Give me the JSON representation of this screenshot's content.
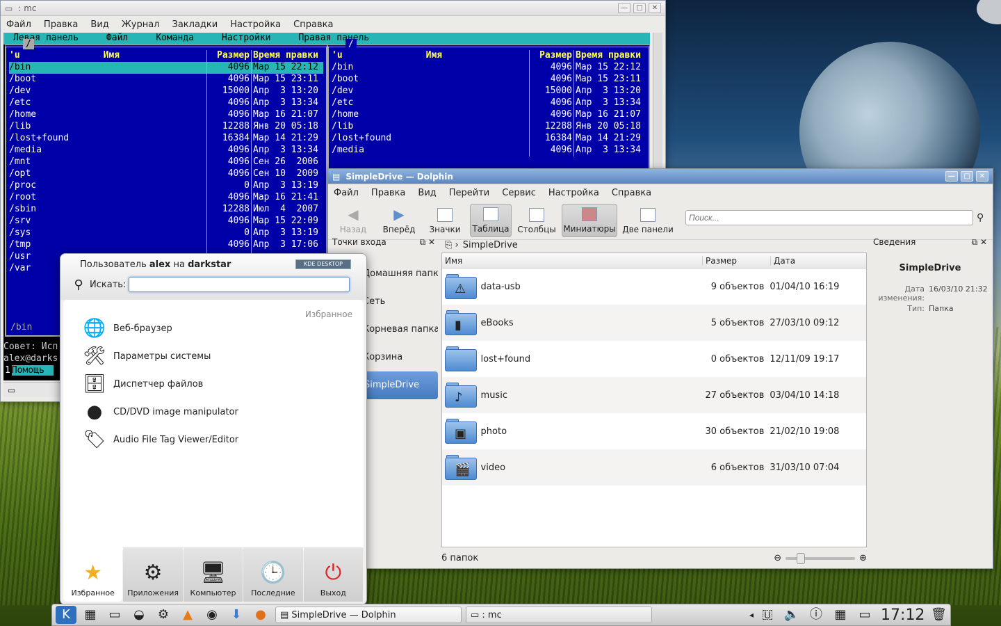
{
  "mc": {
    "title": ": mc",
    "menu": [
      "Файл",
      "Правка",
      "Вид",
      "Журнал",
      "Закладки",
      "Настройка",
      "Справка"
    ],
    "top_menu": [
      "Левая панель",
      "Файл",
      "Команда",
      "Настройки",
      "Правая панель"
    ],
    "columns": [
      "'u",
      "Имя",
      "Размер",
      "Время правки"
    ],
    "left_path": "/",
    "right_path": "/",
    "rows": [
      {
        "name": "/bin",
        "size": "4096",
        "time": "Мар 15 22:12"
      },
      {
        "name": "/boot",
        "size": "4096",
        "time": "Мар 15 23:11"
      },
      {
        "name": "/dev",
        "size": "15000",
        "time": "Апр  3 13:20"
      },
      {
        "name": "/etc",
        "size": "4096",
        "time": "Апр  3 13:34"
      },
      {
        "name": "/home",
        "size": "4096",
        "time": "Мар 16 21:07"
      },
      {
        "name": "/lib",
        "size": "12288",
        "time": "Янв 20 05:18"
      },
      {
        "name": "/lost+found",
        "size": "16384",
        "time": "Мар 14 21:29"
      },
      {
        "name": "/media",
        "size": "4096",
        "time": "Апр  3 13:34"
      },
      {
        "name": "/mnt",
        "size": "4096",
        "time": "Сен 26  2006"
      },
      {
        "name": "/opt",
        "size": "4096",
        "time": "Сен 10  2009"
      },
      {
        "name": "/proc",
        "size": "0",
        "time": "Апр  3 13:19"
      },
      {
        "name": "/root",
        "size": "4096",
        "time": "Мар 16 21:41"
      },
      {
        "name": "/sbin",
        "size": "12288",
        "time": "Июл  4  2007"
      },
      {
        "name": "/srv",
        "size": "4096",
        "time": "Мар 15 22:09"
      },
      {
        "name": "/sys",
        "size": "0",
        "time": "Апр  3 13:19"
      },
      {
        "name": "/tmp",
        "size": "4096",
        "time": "Апр  3 17:06"
      },
      {
        "name": "/usr",
        "size": "",
        "time": ""
      },
      {
        "name": "/var",
        "size": "",
        "time": ""
      }
    ],
    "footer": "/bin",
    "hint": "Совет: Исп",
    "prompt": "alex@darks",
    "fkey": "1",
    "fkey_label": "Помощь"
  },
  "dolphin": {
    "title": "SimpleDrive — Dolphin",
    "menu": [
      "Файл",
      "Правка",
      "Вид",
      "Перейти",
      "Сервис",
      "Настройка",
      "Справка"
    ],
    "toolbar": {
      "back": "Назад",
      "forward": "Вперёд",
      "icons": "Значки",
      "table": "Таблица",
      "columns": "Столбцы",
      "preview": "Миниатюры",
      "split": "Две панели"
    },
    "search_placeholder": "Поиск...",
    "places_title": "Точки входа",
    "places": [
      "Домашняя папка",
      "Сеть",
      "Корневая папка",
      "Корзина",
      "SimpleDrive"
    ],
    "breadcrumb": "SimpleDrive",
    "headers": {
      "name": "Имя",
      "size": "Размер",
      "date": "Дата"
    },
    "files": [
      {
        "name": "data-usb",
        "size": "9 объектов",
        "date": "01/04/10 16:19",
        "emblem": "⚠"
      },
      {
        "name": "eBooks",
        "size": "5 объектов",
        "date": "27/03/10 09:12",
        "emblem": "▮"
      },
      {
        "name": "lost+found",
        "size": "0 объектов",
        "date": "12/11/09 19:17",
        "emblem": ""
      },
      {
        "name": "music",
        "size": "27 объектов",
        "date": "03/04/10 14:18",
        "emblem": "♪"
      },
      {
        "name": "photo",
        "size": "30 объектов",
        "date": "21/02/10 19:08",
        "emblem": "▣"
      },
      {
        "name": "video",
        "size": "6 объектов",
        "date": "31/03/10 07:04",
        "emblem": "🎬"
      }
    ],
    "status": "6 папок",
    "info_title": "Сведения",
    "info": {
      "name": "SimpleDrive",
      "date_label": "Дата изменения:",
      "date": "16/03/10 21:32",
      "type_label": "Тип:",
      "type": "Папка"
    }
  },
  "launcher": {
    "user_prefix": "Пользователь",
    "user": "alex",
    "on": "на",
    "host": "darkstar",
    "badge": "KDE DESKTOP",
    "search_label": "Искать:",
    "category": "Избранное",
    "items": [
      {
        "label": "Веб-браузер",
        "icon": "🌐"
      },
      {
        "label": "Параметры системы",
        "icon": "🛠"
      },
      {
        "label": "Диспетчер файлов",
        "icon": "🗄"
      },
      {
        "label": "CD/DVD image manipulator",
        "icon": "●"
      },
      {
        "label": "Audio File Tag Viewer/Editor",
        "icon": "🏷"
      }
    ],
    "tabs": [
      {
        "label": "Избранное",
        "icon": "★"
      },
      {
        "label": "Приложения",
        "icon": "⚙"
      },
      {
        "label": "Компьютер",
        "icon": "🖥"
      },
      {
        "label": "Последние",
        "icon": "🕒"
      },
      {
        "label": "Выход",
        "icon": "⏻"
      }
    ]
  },
  "taskbar": {
    "tasks": [
      "SimpleDrive — Dolphin",
      ": mc"
    ],
    "clock": "17:12"
  }
}
